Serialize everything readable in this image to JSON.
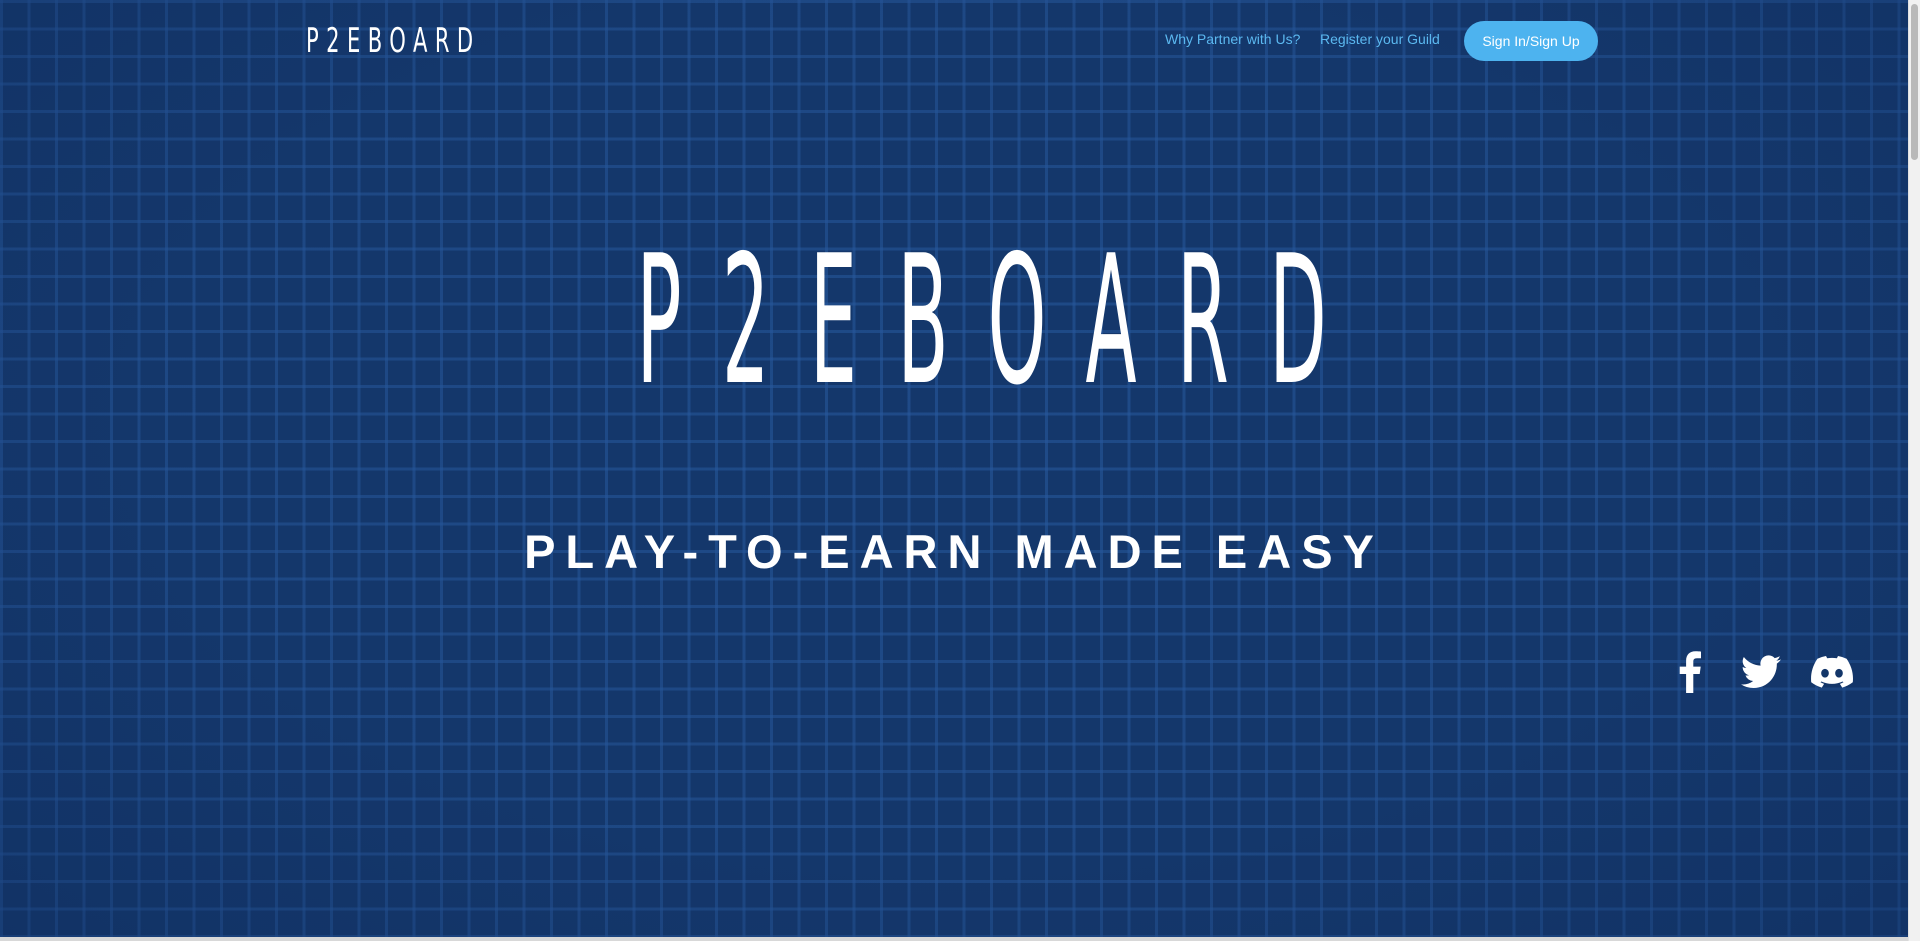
{
  "header": {
    "logo_text": "P2EBOARD",
    "nav_links": [
      {
        "label": "Why Partner with Us?"
      },
      {
        "label": "Register your Guild"
      }
    ],
    "signin_label": "Sign In/Sign Up"
  },
  "hero": {
    "title": "P2EBOARD",
    "tagline": "PLAY-TO-EARN MADE EASY"
  },
  "social": {
    "icons": [
      "facebook-icon",
      "twitter-icon",
      "discord-icon"
    ]
  },
  "colors": {
    "background": "#14376b",
    "grid": "#285aa0",
    "link": "#5bb8f0",
    "button": "#4db3ef",
    "text": "#ffffff"
  }
}
